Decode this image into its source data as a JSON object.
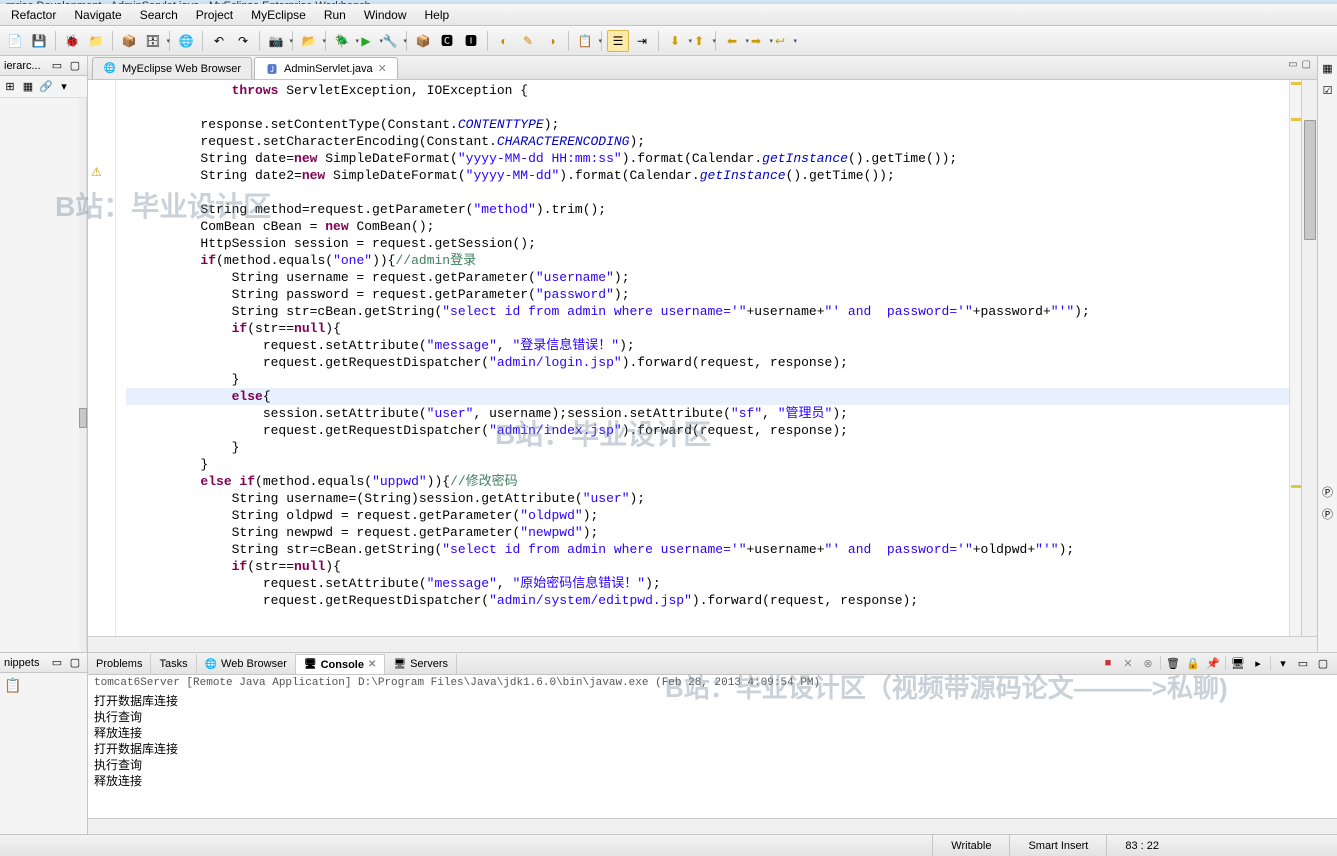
{
  "window_title": "rprise Development - AdminServlet.java - MyEclipse Enterprise Workbench",
  "menu": [
    "Refactor",
    "Navigate",
    "Search",
    "Project",
    "MyEclipse",
    "Run",
    "Window",
    "Help"
  ],
  "left_panel": {
    "title": "ierarc..."
  },
  "tabs": [
    {
      "label": "MyEclipse Web Browser",
      "active": false
    },
    {
      "label": "AdminServlet.java",
      "active": true
    }
  ],
  "code_tokens": [
    [
      [
        "",
        "            "
      ],
      [
        "kw",
        "throws"
      ],
      [
        "",
        " ServletException, IOException {"
      ]
    ],
    [
      [
        "",
        ""
      ]
    ],
    [
      [
        "",
        "        response.setContentType(Constant."
      ],
      [
        "fld",
        "CONTENTTYPE"
      ],
      [
        "",
        ");"
      ]
    ],
    [
      [
        "",
        "        request.setCharacterEncoding(Constant."
      ],
      [
        "fld",
        "CHARACTERENCODING"
      ],
      [
        "",
        ");"
      ]
    ],
    [
      [
        "",
        "        String date="
      ],
      [
        "kw",
        "new"
      ],
      [
        "",
        " SimpleDateFormat("
      ],
      [
        "str",
        "\"yyyy-MM-dd HH:mm:ss\""
      ],
      [
        "",
        ").format(Calendar."
      ],
      [
        "fld",
        "getInstance"
      ],
      [
        "",
        "().getTime());"
      ]
    ],
    [
      [
        "",
        "        String date2="
      ],
      [
        "kw",
        "new"
      ],
      [
        "",
        " SimpleDateFormat("
      ],
      [
        "str",
        "\"yyyy-MM-dd\""
      ],
      [
        "",
        ").format(Calendar."
      ],
      [
        "fld",
        "getInstance"
      ],
      [
        "",
        "().getTime());"
      ]
    ],
    [
      [
        "",
        ""
      ]
    ],
    [
      [
        "",
        "        String method=request.getParameter("
      ],
      [
        "str",
        "\"method\""
      ],
      [
        "",
        ").trim();"
      ]
    ],
    [
      [
        "",
        "        ComBean cBean = "
      ],
      [
        "kw",
        "new"
      ],
      [
        "",
        " ComBean();"
      ]
    ],
    [
      [
        "",
        "        HttpSession session = request.getSession();"
      ]
    ],
    [
      [
        "",
        "        "
      ],
      [
        "kw",
        "if"
      ],
      [
        "",
        "(method.equals("
      ],
      [
        "str",
        "\"one\""
      ],
      [
        "",
        ")){"
      ],
      [
        "cmt",
        "//admin登录"
      ]
    ],
    [
      [
        "",
        "            String username = request.getParameter("
      ],
      [
        "str",
        "\"username\""
      ],
      [
        "",
        ");"
      ]
    ],
    [
      [
        "",
        "            String password = request.getParameter("
      ],
      [
        "str",
        "\"password\""
      ],
      [
        "",
        ");"
      ]
    ],
    [
      [
        "",
        "            String str=cBean.getString("
      ],
      [
        "str",
        "\"select id from admin where username='\""
      ],
      [
        "",
        "+username+"
      ],
      [
        "str",
        "\"' and  password='\""
      ],
      [
        "",
        "+password+"
      ],
      [
        "str",
        "\"'\""
      ],
      [
        "",
        ");"
      ]
    ],
    [
      [
        "",
        "            "
      ],
      [
        "kw",
        "if"
      ],
      [
        "",
        "(str=="
      ],
      [
        "kw",
        "null"
      ],
      [
        "",
        "){"
      ]
    ],
    [
      [
        "",
        "                request.setAttribute("
      ],
      [
        "str",
        "\"message\""
      ],
      [
        "",
        ", "
      ],
      [
        "str",
        "\"登录信息错误！\""
      ],
      [
        "",
        ");"
      ]
    ],
    [
      [
        "",
        "                request.getRequestDispatcher("
      ],
      [
        "str",
        "\"admin/login.jsp\""
      ],
      [
        "",
        ").forward(request, response);"
      ]
    ],
    [
      [
        "",
        "            }"
      ]
    ],
    [
      [
        "",
        "            "
      ],
      [
        "kw",
        "else"
      ],
      [
        "",
        "{"
      ]
    ],
    [
      [
        "",
        "                session.setAttribute("
      ],
      [
        "str",
        "\"user\""
      ],
      [
        "",
        ", username);session.setAttribute("
      ],
      [
        "str",
        "\"sf\""
      ],
      [
        "",
        ", "
      ],
      [
        "str",
        "\"管理员\""
      ],
      [
        "",
        ");"
      ]
    ],
    [
      [
        "",
        "                request.getRequestDispatcher("
      ],
      [
        "str",
        "\"admin/index.jsp\""
      ],
      [
        "",
        ").forward(request, response);"
      ]
    ],
    [
      [
        "",
        "            }"
      ]
    ],
    [
      [
        "",
        "        }"
      ]
    ],
    [
      [
        "",
        "        "
      ],
      [
        "kw",
        "else if"
      ],
      [
        "",
        "(method.equals("
      ],
      [
        "str",
        "\"uppwd\""
      ],
      [
        "",
        ")){"
      ],
      [
        "cmt",
        "//修改密码"
      ]
    ],
    [
      [
        "",
        "            String username=(String)session.getAttribute("
      ],
      [
        "str",
        "\"user\""
      ],
      [
        "",
        ");"
      ]
    ],
    [
      [
        "",
        "            String oldpwd = request.getParameter("
      ],
      [
        "str",
        "\"oldpwd\""
      ],
      [
        "",
        ");"
      ]
    ],
    [
      [
        "",
        "            String newpwd = request.getParameter("
      ],
      [
        "str",
        "\"newpwd\""
      ],
      [
        "",
        ");"
      ]
    ],
    [
      [
        "",
        "            String str=cBean.getString("
      ],
      [
        "str",
        "\"select id from admin where username='\""
      ],
      [
        "",
        "+username+"
      ],
      [
        "str",
        "\"' and  password='\""
      ],
      [
        "",
        "+oldpwd+"
      ],
      [
        "str",
        "\"'\""
      ],
      [
        "",
        ");"
      ]
    ],
    [
      [
        "",
        "            "
      ],
      [
        "kw",
        "if"
      ],
      [
        "",
        "(str=="
      ],
      [
        "kw",
        "null"
      ],
      [
        "",
        "){"
      ]
    ],
    [
      [
        "",
        "                request.setAttribute("
      ],
      [
        "str",
        "\"message\""
      ],
      [
        "",
        ", "
      ],
      [
        "str",
        "\"原始密码信息错误！\""
      ],
      [
        "",
        ");"
      ]
    ],
    [
      [
        "",
        "                request.getRequestDispatcher("
      ],
      [
        "str",
        "\"admin/system/editpwd.jsp\""
      ],
      [
        "",
        ").forward(request, response);"
      ]
    ]
  ],
  "highlight_line": 18,
  "snippets": {
    "title": "nippets"
  },
  "console_tabs": [
    "Problems",
    "Tasks",
    "Web Browser",
    "Console",
    "Servers"
  ],
  "console_active": 3,
  "console_header": "tomcat6Server [Remote Java Application] D:\\Program Files\\Java\\jdk1.6.0\\bin\\javaw.exe (Feb 28, 2013 4:09:54 PM)",
  "console_lines": [
    "打开数据库连接",
    "执行查询",
    "释放连接",
    "打开数据库连接",
    "执行查询",
    "释放连接"
  ],
  "status": {
    "writable": "Writable",
    "insert": "Smart Insert",
    "pos": "83 : 22"
  },
  "watermarks": {
    "w1": "B站：毕业设计区",
    "w2": "B站：毕业设计区",
    "w3": "B站：毕业设计区（视频带源码论文———>私聊)"
  }
}
